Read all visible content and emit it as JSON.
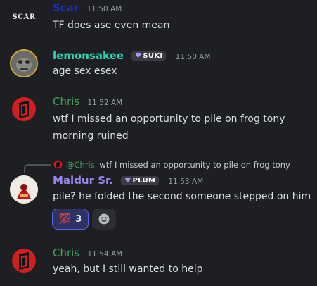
{
  "messages": [
    {
      "author": "Scar",
      "author_color": "#1e2bb3",
      "time": "11:50 AM",
      "text": "TF does ase even mean",
      "avatar_text": "SCAR"
    },
    {
      "author": "lemonsakee",
      "author_color": "#2fd3b8",
      "tag": "SUKI",
      "time": "11:50 AM",
      "text": "age sex esex"
    },
    {
      "author": "Chris",
      "author_color": "#3ba55c",
      "time": "11:52 AM",
      "text_line1": "wtf I missed an opportunity to pile on frog tony",
      "text_line2": "morning ruined"
    },
    {
      "reply_mention": "@Chris",
      "reply_text": "wtf I missed an opportunity to pile on frog tony",
      "author": "Maldur Sr.",
      "author_color": "#9b84ec",
      "tag": "PLUM",
      "time": "11:53 AM",
      "text": "pile? he folded the second someone stepped on him",
      "reaction_emoji": "💯",
      "reaction_count": "3"
    },
    {
      "author": "Chris",
      "author_color": "#3ba55c",
      "time": "11:54 AM",
      "text": "yeah, but I still wanted to help"
    }
  ],
  "icons": {
    "heart": "♥",
    "add_reaction": "smiley-add-reaction-icon"
  }
}
